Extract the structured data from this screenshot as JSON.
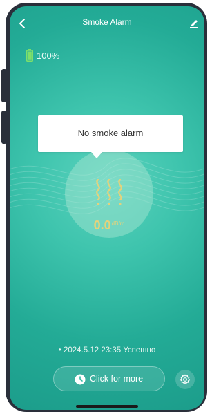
{
  "header": {
    "title": "Smoke Alarm"
  },
  "battery": {
    "level_text": "100%",
    "level_percent": 100
  },
  "tooltip": {
    "text": "No smoke alarm"
  },
  "reading": {
    "value": "0.0",
    "unit": "dB/m"
  },
  "status": {
    "text": "2024.5.12 23:35 Успешно"
  },
  "actions": {
    "more_label": "Click for more"
  },
  "colors": {
    "accent": "#2fb8a2",
    "value": "#e6d27a"
  },
  "icons": {
    "back": "chevron-left-icon",
    "edit": "edit-icon",
    "battery": "battery-icon",
    "smoke": "smoke-icon",
    "clock": "clock-icon",
    "settings": "gear-icon"
  }
}
